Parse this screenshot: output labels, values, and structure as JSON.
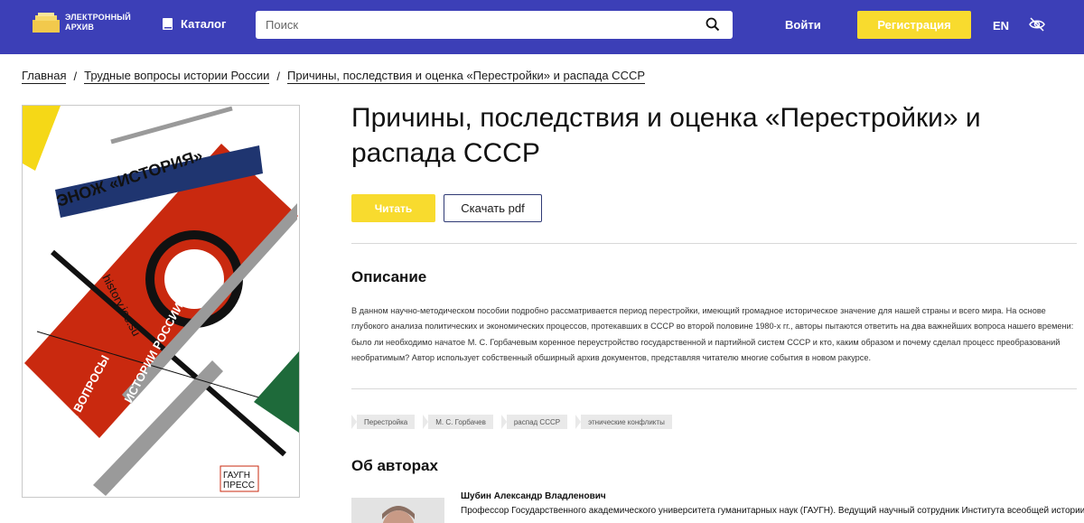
{
  "header": {
    "logo_line1": "ЭЛЕКТРОННЫЙ",
    "logo_line2": "АРХИВ",
    "catalog_label": "Каталог",
    "search_placeholder": "Поиск",
    "login_label": "Войти",
    "register_label": "Регистрация",
    "lang_label": "EN"
  },
  "breadcrumb": {
    "items": [
      "Главная",
      "Трудные вопросы истории России",
      "Причины, последствия и оценка «Перестройки» и распада СССР"
    ],
    "separator": "/"
  },
  "cover": {
    "series": "ЭНОЖ «ИСТОРИЯ»",
    "site": "history.jes.su",
    "title_line1": "ИСТОРИИ РОССИИ",
    "title_line2": "ТРУДНЫЕ ВОПРОСЫ",
    "publisher_line1": "ГАУГН",
    "publisher_line2": "ПРЕСС"
  },
  "book": {
    "title": "Причины, последствия и оценка «Перестройки» и распада СССР",
    "read_label": "Читать",
    "pdf_label": "Скачать pdf"
  },
  "description": {
    "heading": "Описание",
    "text": "В данном научно-методическом пособии подробно рассматривается период перестройки, имеющий громадное историческое значение для нашей страны и всего мира. На основе глубокого анализа политических и экономических процессов, протекавших в СССР во второй половине 1980-х гг., авторы пытаются ответить на два важнейших вопроса нашего времени: было ли необходимо начатое М. С. Горбачевым коренное переустройство государственной и партийной систем СССР и кто, каким образом и почему сделал процесс преобразований необратимым? Автор использует собственный обширный архив документов, представляя читателю многие события в новом ракурсе."
  },
  "tags": [
    "Перестройка",
    "М. С. Горбачев",
    "распад СССР",
    "этнические конфликты"
  ],
  "authors": {
    "heading": "Об авторах",
    "items": [
      {
        "name": "Шубин Александр Владленович",
        "bio": "Профессор Государственного академического университета гуманитарных наук (ГАУГН). Ведущий научный сотрудник Института всеобщей истории РАН"
      }
    ]
  },
  "colors": {
    "header_bg": "#3c3fb7",
    "accent_yellow": "#f8db2e",
    "cover_red": "#c9290f",
    "cover_navy": "#1f3570",
    "cover_green": "#1e6a3a"
  }
}
